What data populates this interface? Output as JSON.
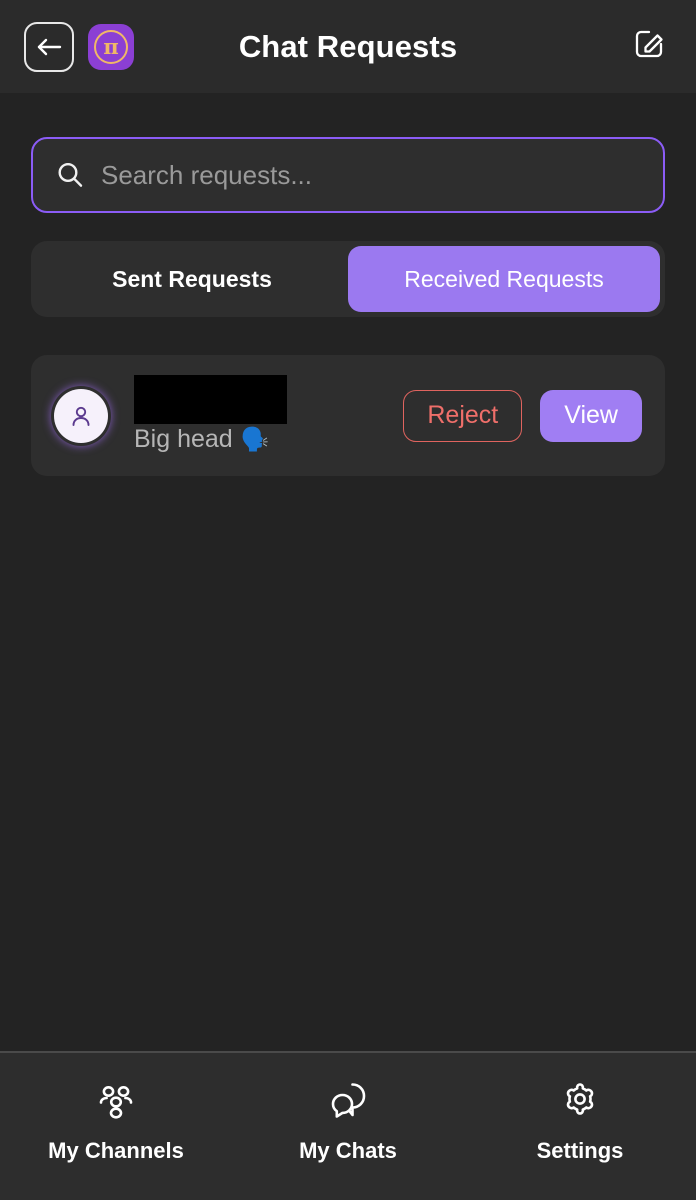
{
  "header": {
    "title": "Chat Requests",
    "back_icon": "arrow-left-icon",
    "logo_icon": "pi-network-logo",
    "logo_glyph": "π",
    "compose_icon": "compose-edit-icon"
  },
  "search": {
    "icon": "search-icon",
    "placeholder": "Search requests...",
    "value": ""
  },
  "tabs": {
    "items": [
      {
        "label": "Sent Requests",
        "active": false
      },
      {
        "label": "Received Requests",
        "active": true
      }
    ]
  },
  "requests": [
    {
      "avatar_icon": "user-avatar-icon",
      "display_name": "",
      "name_redacted": true,
      "subtitle": "Big head",
      "subtitle_emoji": "🗣️",
      "reject_label": "Reject",
      "view_label": "View"
    }
  ],
  "footer": {
    "items": [
      {
        "label": "My Channels",
        "icon": "users-group-icon"
      },
      {
        "label": "My Chats",
        "icon": "chat-bubbles-icon"
      },
      {
        "label": "Settings",
        "icon": "gear-icon"
      }
    ]
  },
  "colors": {
    "background": "#232323",
    "surface": "#2e2e2e",
    "header_bg": "#2b2b2b",
    "footer_bg": "#2d2d2d",
    "accent_purple": "#8b5cf6",
    "active_tab": "#9b79f0",
    "view_button": "#a07ef3",
    "reject_red": "#ef6f6a",
    "logo_purple": "#8b3fd4",
    "logo_gold": "#f0b867",
    "text_primary": "#ffffff",
    "text_muted": "#b6b6b6",
    "placeholder": "#9a9a9a"
  }
}
